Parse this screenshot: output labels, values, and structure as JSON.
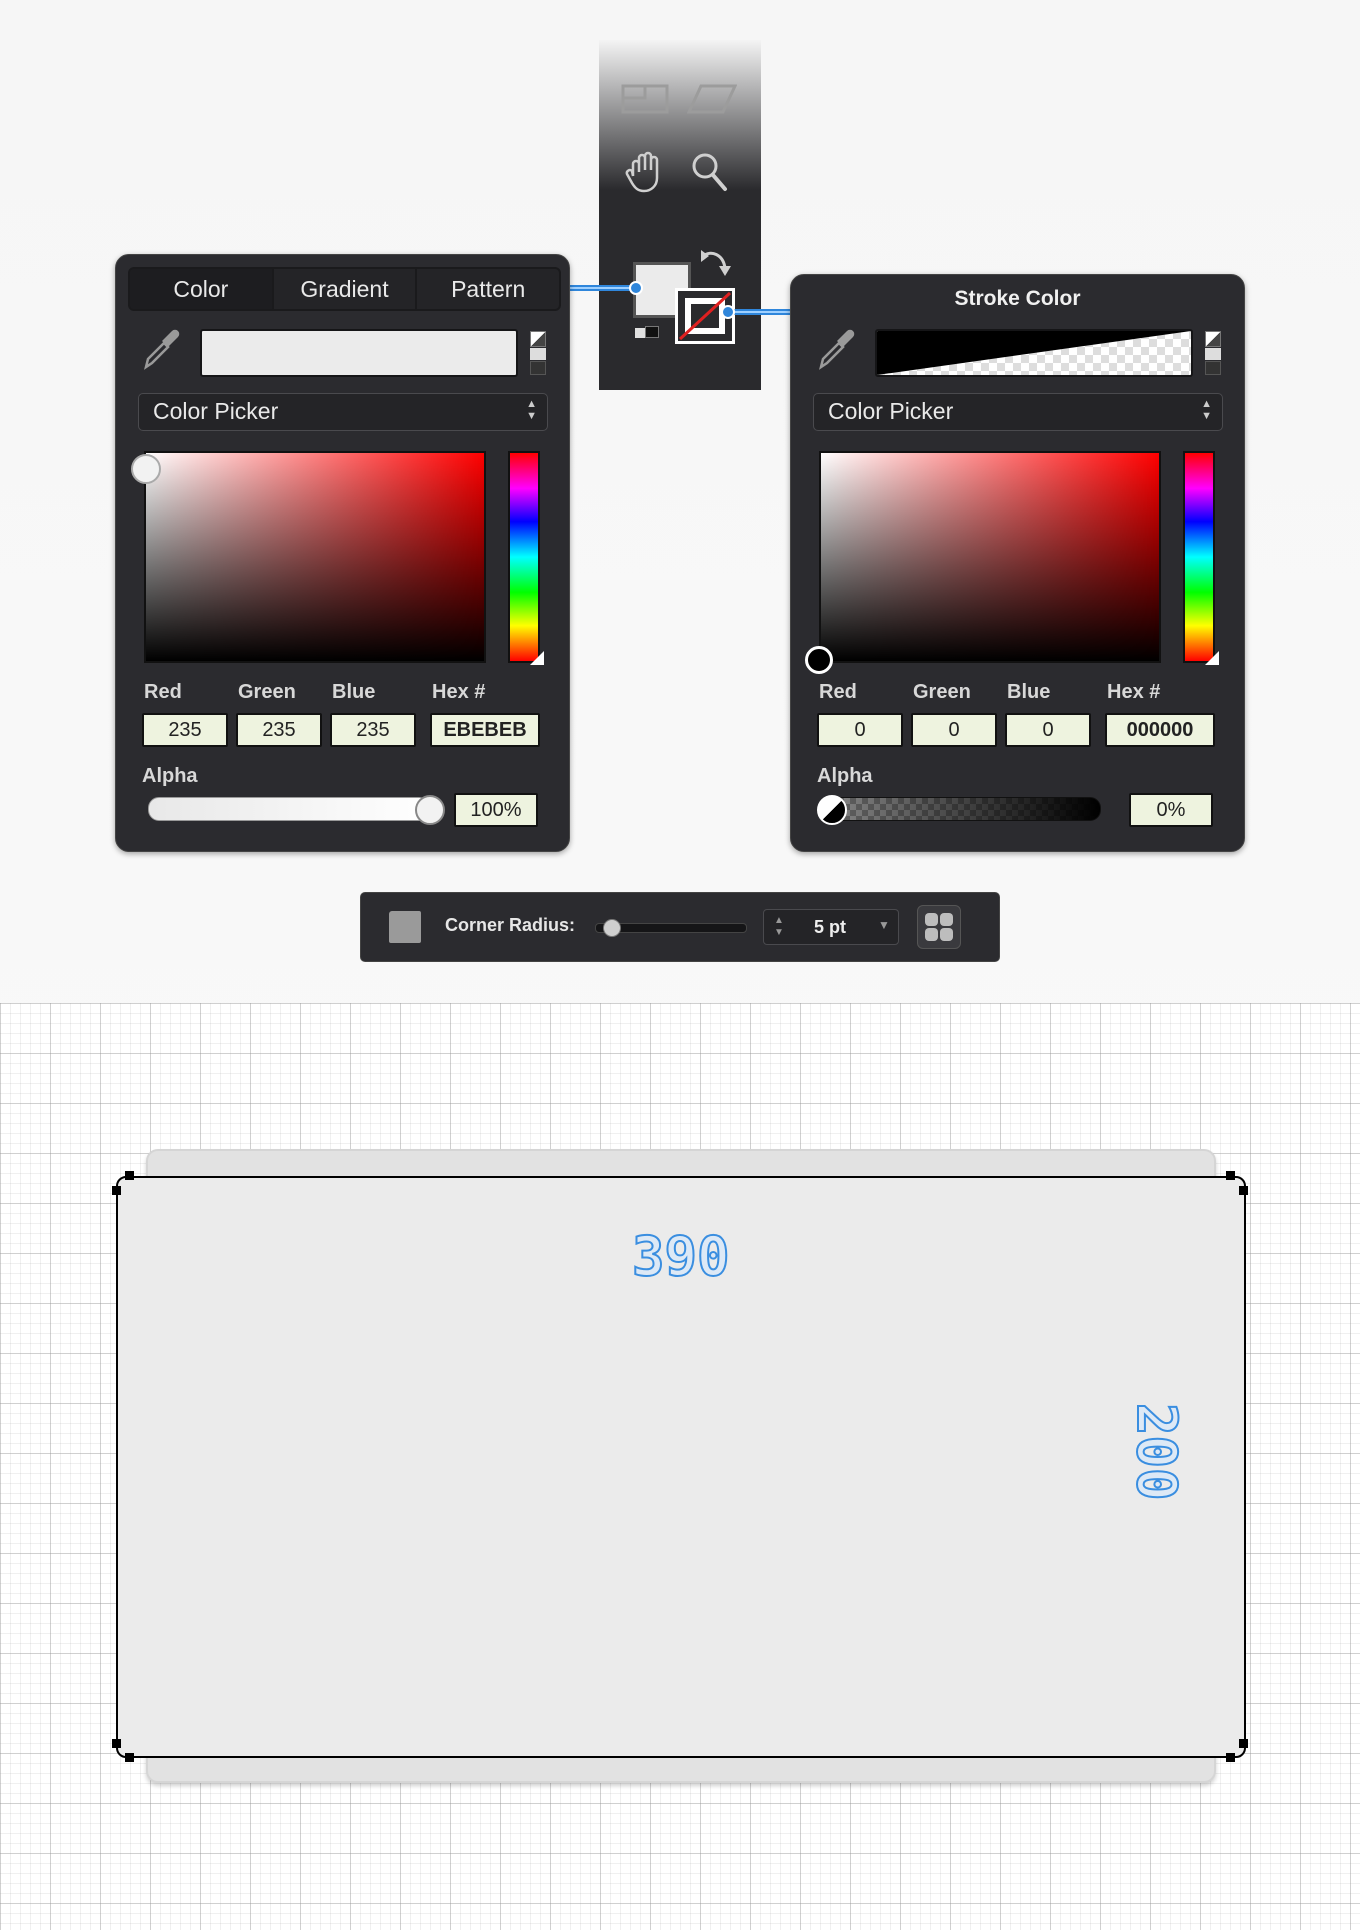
{
  "fill_panel": {
    "tabs": [
      "Color",
      "Gradient",
      "Pattern"
    ],
    "mode": "Color Picker",
    "fields": {
      "labels": [
        "Red",
        "Green",
        "Blue",
        "Hex #"
      ],
      "red": "235",
      "green": "235",
      "blue": "235",
      "hex": "EBEBEB"
    },
    "alpha_label": "Alpha",
    "alpha_value": "100%",
    "alpha_fraction": 1.0,
    "color": "#ebebeb"
  },
  "stroke_panel": {
    "title": "Stroke Color",
    "mode": "Color Picker",
    "fields": {
      "labels": [
        "Red",
        "Green",
        "Blue",
        "Hex #"
      ],
      "red": "0",
      "green": "0",
      "blue": "0",
      "hex": "000000"
    },
    "alpha_label": "Alpha",
    "alpha_value": "0%",
    "alpha_fraction": 0.0,
    "color": "#000000"
  },
  "toolbar": {
    "icons": [
      "transform-icon",
      "shear-icon",
      "hand-icon",
      "zoom-icon",
      "swap-colors-icon",
      "fill-swatch",
      "stroke-swatch",
      "default-colors-icon"
    ]
  },
  "corner_radius": {
    "label": "Corner Radius:",
    "value": "5 pt",
    "slider_fraction": 0.05
  },
  "canvas": {
    "width_label": "390",
    "height_label": "200",
    "shape_fill": "#ebebeb",
    "accent": "#3a8ee0"
  }
}
